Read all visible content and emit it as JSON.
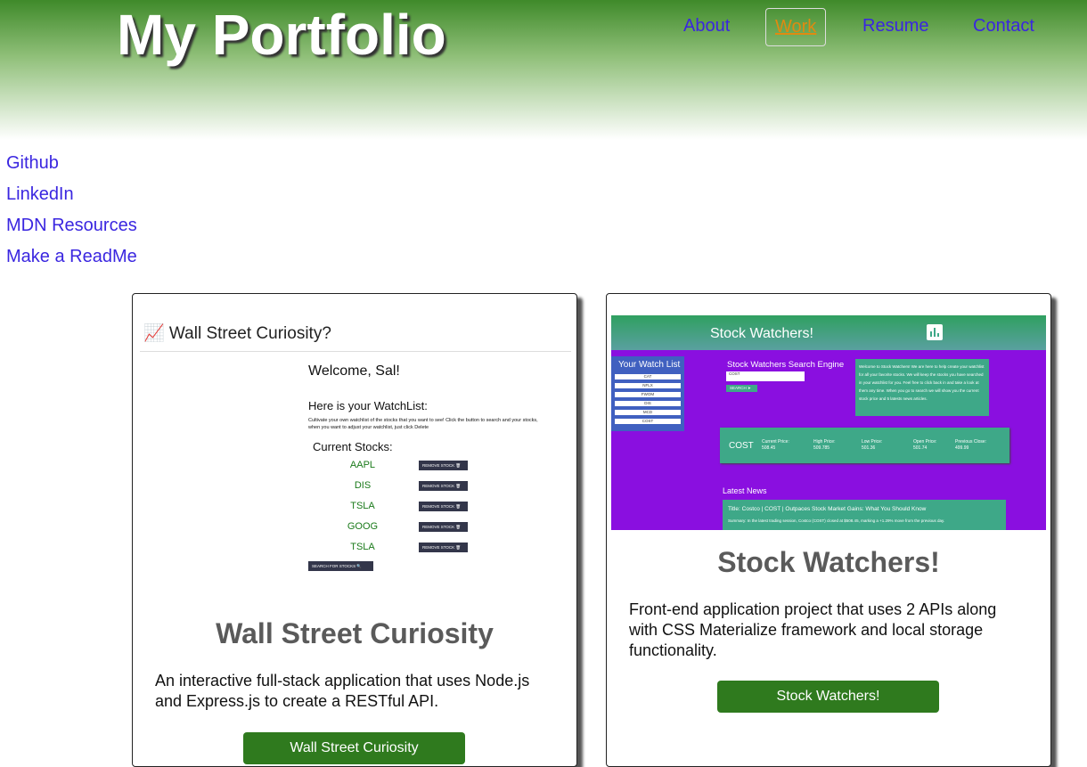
{
  "header": {
    "title": "My Portfolio",
    "nav": {
      "about": "About",
      "work": "Work",
      "resume": "Resume",
      "contact": "Contact"
    }
  },
  "sidebar_links": [
    "Github",
    "LinkedIn",
    "MDN Resources",
    "Make a ReadMe"
  ],
  "projects": [
    {
      "title": "Wall Street Curiosity",
      "description": "An interactive full-stack application that uses Node.js and Express.js to create a RESTful API.",
      "button": "Wall Street Curiosity",
      "preview": {
        "header": "📈 Wall Street Curiosity?",
        "welcome": "Welcome, Sal!",
        "watchlist_heading": "Here is your WatchList:",
        "instructions_1": "Cultivate your own watchlist of the stocks that you want to see! Click the button to search and your stocks,",
        "instructions_2": "when you want to adjust your watchlist, just click Delete",
        "current_stocks": "Current Stocks:",
        "stocks": [
          "AAPL",
          "DIS",
          "TSLA",
          "GOOG",
          "TSLA"
        ],
        "remove_label": "REMOVE STOCK 🗑",
        "search_button": "SEARCH FOR STOCKS 🔍"
      }
    },
    {
      "title": "Stock Watchers!",
      "description": "Front-end application project that uses 2 APIs along with CSS Materialize framework and local storage functionality.",
      "button": "Stock Watchers!",
      "preview": {
        "app_title": "Stock Watchers!",
        "watch_list_title": "Your Watch List",
        "watch_list": [
          "CAT",
          "NFLX",
          "FWOM",
          "DIS",
          "MCD",
          "COST"
        ],
        "search_title": "Stock Watchers Search Engine",
        "search_value": "COST",
        "search_button": "SEARCH ➤",
        "intro": "Welcome to Stock Watchers! We are here to help create your watchlist for all your favorite stocks. We will keep the stocks you have searched in your watchlist for you. Feel free to click back in and take a look at them any time. When you go to search we will show you the current stock price and 5 latests news articles.",
        "quote_symbol": "COST",
        "current_price_label": "Current Price:",
        "current_price": "508.45",
        "high_label": "High Price:",
        "high": "509.785",
        "low_label": "Low Price:",
        "low": "501.36",
        "open_label": "Open Price:",
        "open": "501.74",
        "prev_label": "Previous Close:",
        "prev": "499.99",
        "news_heading": "Latest News",
        "news_title": "Title: Costco | COST | Outpaces Stock Market Gains: What You Should Know",
        "news_summary": "Summary: In the latest trading session, Costco (COST) closed at $508.45, marking a +1.29% move from the previous day."
      }
    }
  ]
}
